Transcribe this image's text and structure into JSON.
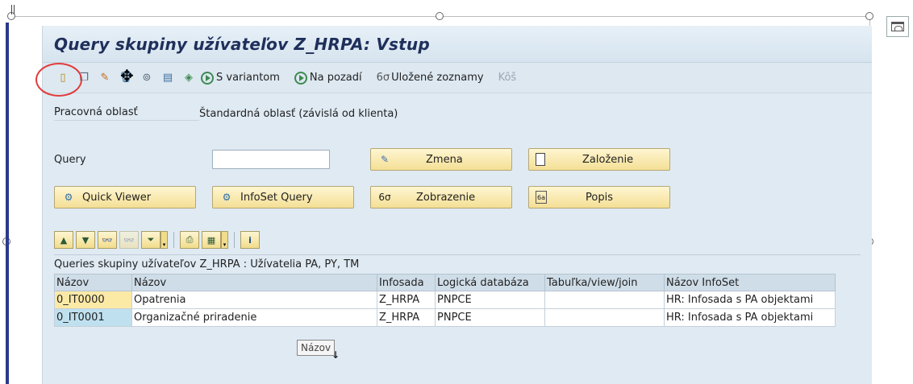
{
  "window": {
    "title": "Query skupiny užívateľov Z_HRPA: Vstup"
  },
  "toolbar": {
    "icons": [
      "create-icon",
      "copy-icon",
      "change-icon",
      "delete-icon",
      "info-icon",
      "transport-icon",
      "execute-icon"
    ],
    "execute_variant_label": "S variantom",
    "background_label": "Na pozadí",
    "saved_lists_label": "Uložené zoznamy",
    "trash_label": "Kôš"
  },
  "form": {
    "workspace_label": "Pracovná oblasť",
    "workspace_value": "Štandardná oblasť (závislá od klienta)",
    "query_label": "Query",
    "query_value": "",
    "change_button": "Zmena",
    "create_button": "Založenie",
    "quick_viewer_button": "Quick Viewer",
    "infoset_query_button": "InfoSet Query",
    "display_button": "Zobrazenie",
    "description_button": "Popis"
  },
  "grid": {
    "title": "Queries skupiny užívateľov Z_HRPA : Užívatelia PA, PY, TM",
    "columns": [
      "Názov",
      "Názov",
      "Infosada",
      "Logická databáza",
      "Tabuľka/view/join",
      "Názov InfoSet"
    ],
    "rows": [
      [
        "0_IT0000",
        "Opatrenia",
        "Z_HRPA",
        "PNPCE",
        "",
        "HR: Infosada s PA objektami"
      ],
      [
        "0_IT0001",
        "Organizačné priradenie",
        "Z_HRPA",
        "PNPCE",
        "",
        "HR: Infosada s PA objektami"
      ]
    ],
    "tooltip": "Názov"
  }
}
